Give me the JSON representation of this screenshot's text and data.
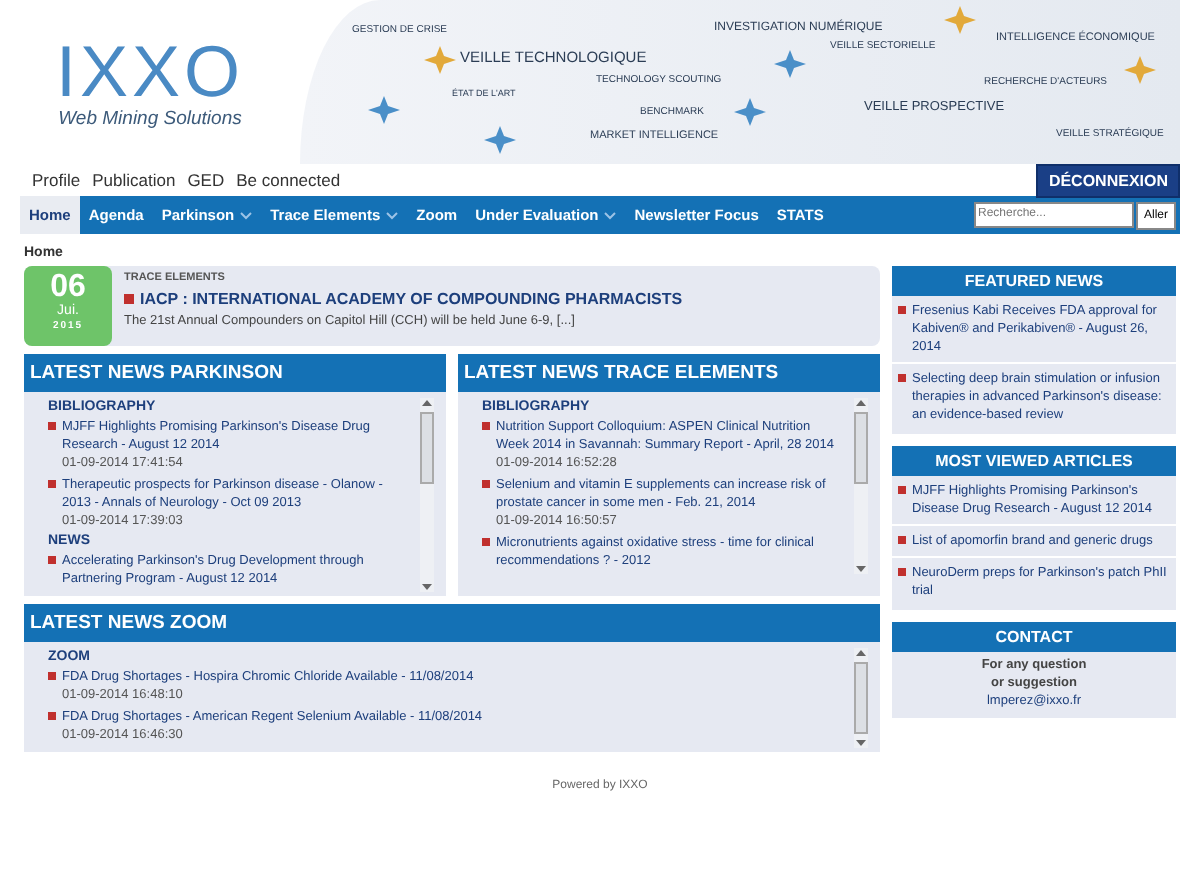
{
  "header": {
    "logo": "IXXO",
    "tagline": "Web Mining Solutions",
    "banner_labels": [
      "GESTION DE CRISE",
      "VEILLE TECHNOLOGIQUE",
      "ÉTAT DE L'ART",
      "TECHNOLOGY SCOUTING",
      "BENCHMARK",
      "MARKET INTELLIGENCE",
      "INVESTIGATION NUMÉRIQUE",
      "VEILLE SECTORIELLE",
      "VEILLE PROSPECTIVE",
      "INTELLIGENCE ÉCONOMIQUE",
      "RECHERCHE D'ACTEURS",
      "VEILLE STRATÉGIQUE"
    ]
  },
  "top_links": [
    "Profile",
    "Publication",
    "GED",
    "Be connected"
  ],
  "logout_button": "DÉCONNEXION",
  "nav": [
    {
      "label": "Home",
      "selected": true,
      "dropdown": false
    },
    {
      "label": "Agenda",
      "selected": false,
      "dropdown": false
    },
    {
      "label": "Parkinson",
      "selected": false,
      "dropdown": true
    },
    {
      "label": "Trace Elements",
      "selected": false,
      "dropdown": true
    },
    {
      "label": "Zoom",
      "selected": false,
      "dropdown": false
    },
    {
      "label": "Under Evaluation",
      "selected": false,
      "dropdown": true
    },
    {
      "label": "Newsletter Focus",
      "selected": false,
      "dropdown": false
    },
    {
      "label": "STATS",
      "selected": false,
      "dropdown": false
    }
  ],
  "search": {
    "placeholder": "Recherche...",
    "button": "Aller"
  },
  "breadcrumb": "Home",
  "featured": {
    "day": "06",
    "month": "Jui.",
    "year": "2015",
    "category": "TRACE ELEMENTS",
    "title": "IACP : INTERNATIONAL ACADEMY OF COMPOUNDING PHARMACISTS",
    "summary": "The 21st Annual Compounders on Capitol Hill (CCH) will be held June 6-9, [...]"
  },
  "panels": [
    {
      "title": "LATEST NEWS PARKINSON",
      "sections": [
        {
          "heading": "BIBLIOGRAPHY",
          "items": [
            {
              "title": "MJFF Highlights Promising Parkinson's Disease Drug Research - August 12 2014",
              "date": "01-09-2014 17:41:54"
            },
            {
              "title": "Therapeutic prospects for Parkinson disease - Olanow - 2013 - Annals of Neurology - Oct 09 2013",
              "date": "01-09-2014 17:39:03"
            }
          ]
        },
        {
          "heading": "NEWS",
          "items": [
            {
              "title": "Accelerating Parkinson's Drug Development through Partnering Program - August 12 2014"
            }
          ]
        }
      ]
    },
    {
      "title": "LATEST NEWS TRACE ELEMENTS",
      "sections": [
        {
          "heading": "BIBLIOGRAPHY",
          "items": [
            {
              "title": "Nutrition Support Colloquium: ASPEN Clinical Nutrition Week 2014 in Savannah: Summary Report - April, 28 2014",
              "date": "01-09-2014 16:52:28"
            },
            {
              "title": "Selenium and vitamin E supplements can increase risk of prostate cancer in some men - Feb. 21, 2014",
              "date": "01-09-2014 16:50:57"
            },
            {
              "title": "Micronutrients against oxidative stress - time for clinical recommendations ? - 2012"
            }
          ]
        }
      ]
    },
    {
      "title": "LATEST NEWS ZOOM",
      "sections": [
        {
          "heading": "ZOOM",
          "items": [
            {
              "title": "FDA Drug Shortages - Hospira Chromic Chloride Available - 11/08/2014",
              "date": "01-09-2014 16:48:10"
            },
            {
              "title": "FDA Drug Shortages - American Regent Selenium Available - 11/08/2014",
              "date": "01-09-2014 16:46:30"
            }
          ]
        }
      ]
    }
  ],
  "sidebar": [
    {
      "title": "FEATURED NEWS",
      "kind": "list",
      "items": [
        "Fresenius Kabi Receives FDA approval for Kabiven® and Perikabiven® - August 26, 2014",
        "Selecting deep brain stimulation or infusion therapies in advanced Parkinson's disease: an evidence-based review"
      ]
    },
    {
      "title": "MOST VIEWED ARTICLES",
      "kind": "list",
      "items": [
        "MJFF Highlights Promising Parkinson's Disease Drug Research - August 12 2014",
        "List of apomorfin brand and generic drugs",
        "NeuroDerm preps for Parkinson's patch PhII trial"
      ]
    },
    {
      "title": "CONTACT",
      "kind": "contact",
      "lines": [
        "For any question",
        "or suggestion"
      ],
      "email": "lmperez@ixxo.fr"
    }
  ],
  "footer": "Powered by IXXO"
}
